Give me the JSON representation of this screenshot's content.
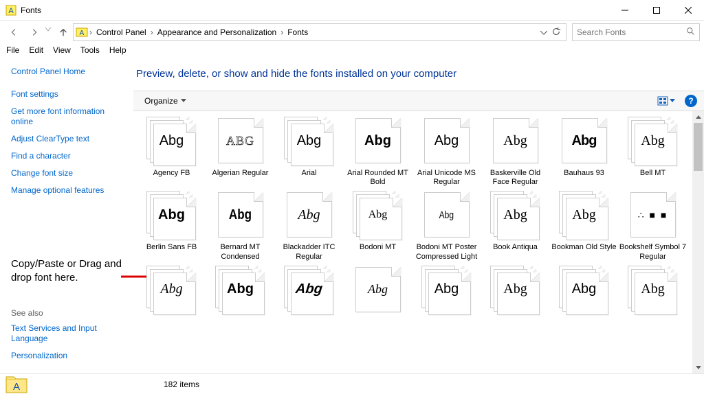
{
  "window": {
    "title": "Fonts"
  },
  "breadcrumbs": {
    "a": "Control Panel",
    "b": "Appearance and Personalization",
    "c": "Fonts"
  },
  "search": {
    "placeholder": "Search Fonts"
  },
  "menu": {
    "file": "File",
    "edit": "Edit",
    "view": "View",
    "tools": "Tools",
    "help": "Help"
  },
  "sidebar": {
    "home": "Control Panel Home",
    "links": {
      "settings": "Font settings",
      "moreinfo": "Get more font information online",
      "cleartype": "Adjust ClearType text",
      "findchar": "Find a character",
      "changesize": "Change font size",
      "optional": "Manage optional features"
    },
    "note": "Copy/Paste or Drag and drop font here.",
    "see_also": "See also",
    "tsil": "Text Services and Input Language",
    "personalization": "Personalization"
  },
  "heading": "Preview, delete, or show and hide the fonts installed on your computer",
  "toolbar": {
    "organize": "Organize"
  },
  "fonts": [
    {
      "label": "Agency FB",
      "sample": "Abg",
      "multi": true,
      "cls": "fs-sans"
    },
    {
      "label": "Algerian Regular",
      "sample": "ABG",
      "multi": false,
      "cls": "fs-engraved"
    },
    {
      "label": "Arial",
      "sample": "Abg",
      "multi": true,
      "cls": "fs-sans"
    },
    {
      "label": "Arial Rounded MT Bold",
      "sample": "Abg",
      "multi": false,
      "cls": "fs-roundbold"
    },
    {
      "label": "Arial Unicode MS Regular",
      "sample": "Abg",
      "multi": false,
      "cls": "fs-sans"
    },
    {
      "label": "Baskerville Old Face Regular",
      "sample": "Abg",
      "multi": false,
      "cls": "fs-thin"
    },
    {
      "label": "Bauhaus 93",
      "sample": "Abg",
      "multi": false,
      "cls": "fs-rounded"
    },
    {
      "label": "Bell MT",
      "sample": "Abg",
      "multi": true,
      "cls": "fs-thin"
    },
    {
      "label": "Berlin Sans FB",
      "sample": "Abg",
      "multi": true,
      "cls": "fs-roundbold"
    },
    {
      "label": "Bernard MT Condensed",
      "sample": "Abg",
      "multi": false,
      "cls": "fs-condbold"
    },
    {
      "label": "Blackadder ITC Regular",
      "sample": "Abg",
      "multi": false,
      "cls": "fs-script"
    },
    {
      "label": "Bodoni MT",
      "sample": "Abg",
      "multi": true,
      "cls": "fs-small"
    },
    {
      "label": "Bodoni MT Poster Compressed Light",
      "sample": "Abg",
      "multi": false,
      "cls": "fs-smallcond"
    },
    {
      "label": "Book Antiqua",
      "sample": "Abg",
      "multi": true,
      "cls": "fs-normal"
    },
    {
      "label": "Bookman Old Style",
      "sample": "Abg",
      "multi": true,
      "cls": "fs-normal"
    },
    {
      "label": "Bookshelf Symbol 7 Regular",
      "sample": "∴ ■ ■",
      "multi": false,
      "cls": "fs-symbols"
    },
    {
      "label": "",
      "sample": "Abg",
      "multi": true,
      "cls": "fs-hand"
    },
    {
      "label": "",
      "sample": "Abg",
      "multi": true,
      "cls": "fs-roundbold"
    },
    {
      "label": "",
      "sample": "Abg",
      "multi": true,
      "cls": "fs-slab"
    },
    {
      "label": "",
      "sample": "Abg",
      "multi": false,
      "cls": "fs-script2"
    },
    {
      "label": "",
      "sample": "Abg",
      "multi": true,
      "cls": "fs-sans"
    },
    {
      "label": "",
      "sample": "Abg",
      "multi": true,
      "cls": "fs-normal"
    },
    {
      "label": "",
      "sample": "Abg",
      "multi": true,
      "cls": "fs-sans"
    },
    {
      "label": "",
      "sample": "Abg",
      "multi": true,
      "cls": "fs-normal"
    }
  ],
  "status": {
    "count": "182 items"
  }
}
